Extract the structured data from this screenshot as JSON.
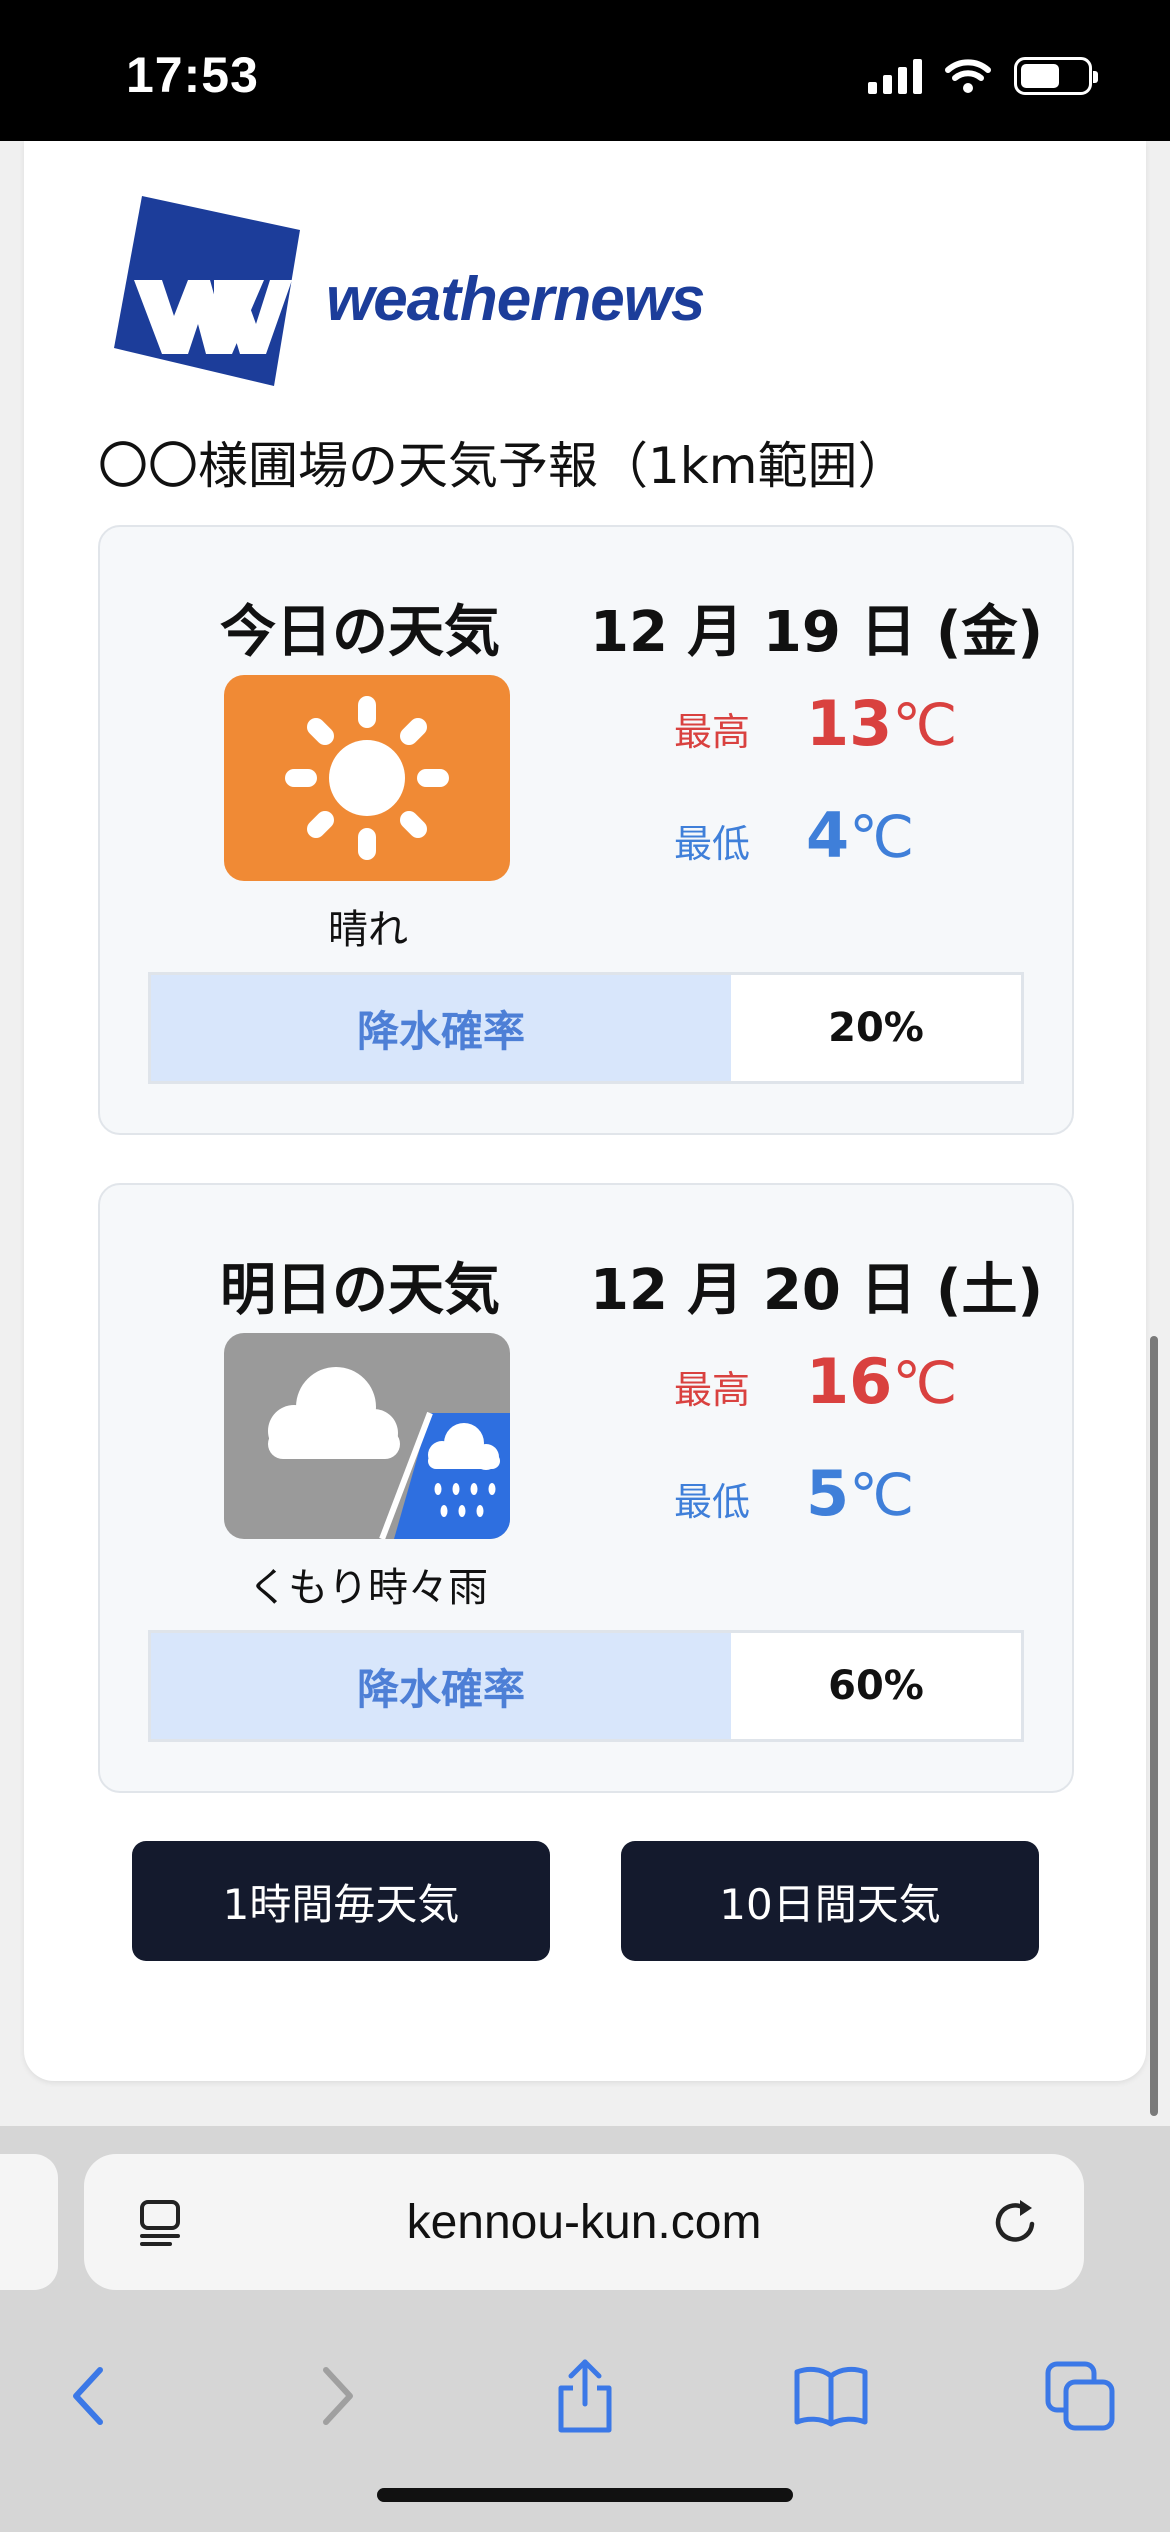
{
  "status_bar": {
    "time": "17:53"
  },
  "logo": {
    "text": "weathernews",
    "mark": "WN"
  },
  "forecast_title": "〇〇様圃場の天気予報（1km範囲）",
  "days": [
    {
      "label": "今日の天気",
      "date": "12 月 19 日 (金)",
      "icon": "sunny-icon",
      "weather": "晴れ",
      "high_label": "最高",
      "high": "13",
      "unit": "℃",
      "low_label": "最低",
      "low": "4",
      "precip_label": "降水確率",
      "precip": "20%"
    },
    {
      "label": "明日の天気",
      "date": "12 月 20 日 (土)",
      "icon": "cloudy-occasional-rain-icon",
      "weather": "くもり時々雨",
      "high_label": "最高",
      "high": "16",
      "unit": "℃",
      "low_label": "最低",
      "low": "5",
      "precip_label": "降水確率",
      "precip": "60%"
    }
  ],
  "buttons": {
    "hourly": "1時間毎天気",
    "ten_day": "10日間天気"
  },
  "browser": {
    "url": "kennou-kun.com"
  },
  "colors": {
    "high": "#d9413f",
    "low": "#3f7fd9",
    "button": "#141a2d",
    "brand": "#1c3d9a",
    "sunny_bg": "#f08a35",
    "rain_bg": "#2e6fe0"
  }
}
